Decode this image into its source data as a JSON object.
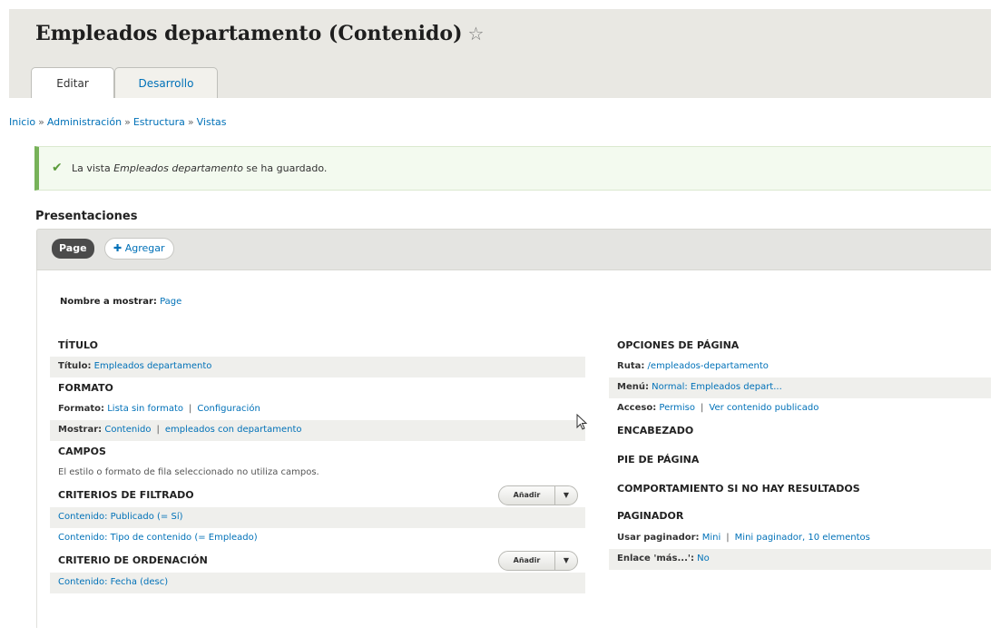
{
  "header": {
    "title": "Empleados departamento (Contenido)",
    "star_icon": "☆",
    "tabs": [
      {
        "label": "Editar"
      },
      {
        "label": "Desarrollo"
      }
    ]
  },
  "breadcrumb": [
    {
      "label": "Inicio"
    },
    {
      "label": "Administración"
    },
    {
      "label": "Estructura"
    },
    {
      "label": "Vistas"
    }
  ],
  "breadcrumb_separator": "»",
  "status_message": {
    "prefix": "La vista ",
    "view_name": "Empleados departamento",
    "suffix": " se ha guardado."
  },
  "displays": {
    "heading": "Presentaciones",
    "active": "Page",
    "add_label": "✚ Agregar",
    "display_name_label": "Nombre a mostrar:",
    "display_name_value": "Page"
  },
  "left": {
    "titulo": {
      "heading": "TÍTULO",
      "label": "Título:",
      "value": "Empleados departamento"
    },
    "formato": {
      "heading": "FORMATO",
      "formato_label": "Formato:",
      "formato_value": "Lista sin formato",
      "formato_settings": "Configuración",
      "mostrar_label": "Mostrar:",
      "mostrar_value": "Contenido",
      "mostrar_settings": "empleados con departamento"
    },
    "campos": {
      "heading": "CAMPOS",
      "note": "El estilo o formato de fila seleccionado no utiliza campos."
    },
    "filtros": {
      "heading": "CRITERIOS DE FILTRADO",
      "add_label": "Añadir",
      "items": [
        "Contenido: Publicado (= Sí)",
        "Contenido: Tipo de contenido (= Empleado)"
      ]
    },
    "orden": {
      "heading": "CRITERIO DE ORDENACIÓN",
      "add_label": "Añadir",
      "items": [
        "Contenido: Fecha (desc)"
      ]
    }
  },
  "right": {
    "pagina": {
      "heading": "OPCIONES DE PÁGINA",
      "ruta_label": "Ruta:",
      "ruta_value": "/empleados-departamento",
      "menu_label": "Menú:",
      "menu_value": "Normal: Empleados depart...",
      "acceso_label": "Acceso:",
      "acceso_value": "Permiso",
      "acceso_settings": "Ver contenido publicado"
    },
    "encabezado": "ENCABEZADO",
    "pie": "PIE DE PÁGINA",
    "sin_resultados": "COMPORTAMIENTO SI NO HAY RESULTADOS",
    "paginador": {
      "heading": "PAGINADOR",
      "usar_label": "Usar paginador:",
      "usar_value": "Mini",
      "usar_settings": "Mini paginador, 10 elementos",
      "mas_label": "Enlace 'más...':",
      "mas_value": "No"
    }
  },
  "colors": {
    "link": "#0071b8",
    "success": "#77b259",
    "dark_pill": "#4b4b4b"
  }
}
